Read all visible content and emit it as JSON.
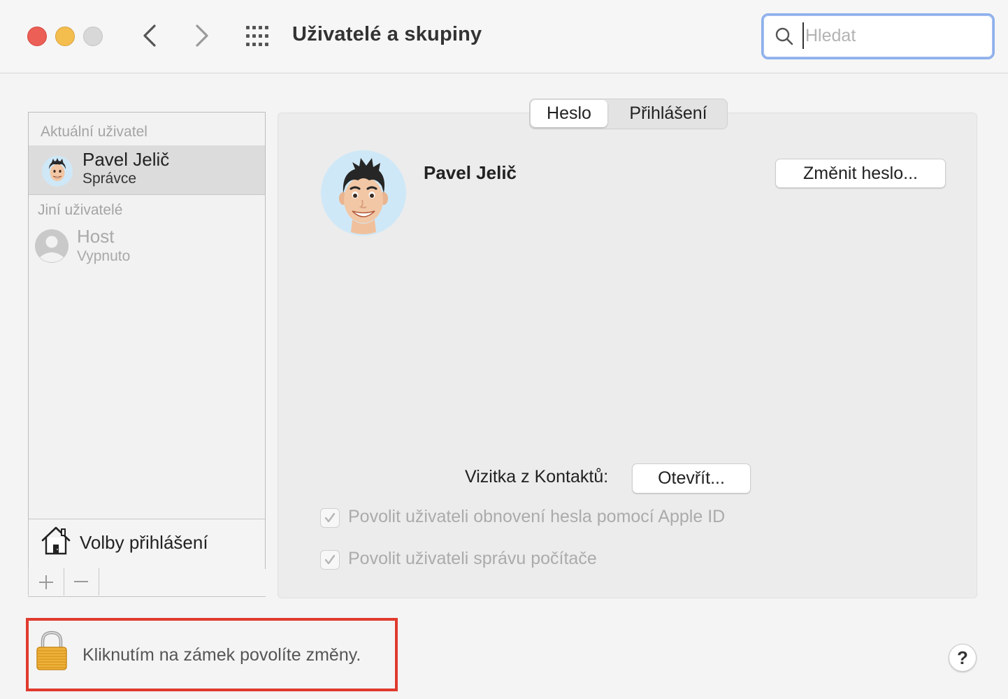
{
  "window": {
    "title": "Uživatelé a skupiny"
  },
  "search": {
    "placeholder": "Hledat",
    "value": ""
  },
  "sidebar": {
    "current_section_label": "Aktuální uživatel",
    "current_user": {
      "name": "Pavel Jelič",
      "role": "Správce"
    },
    "other_section_label": "Jiní uživatelé",
    "guest_user": {
      "name": "Host",
      "status": "Vypnuto"
    },
    "login_options_label": "Volby přihlášení"
  },
  "tabs": {
    "password": "Heslo",
    "login": "Přihlášení"
  },
  "panel": {
    "user_name": "Pavel Jelič",
    "change_password_button": "Změnit heslo...",
    "contact_card_label": "Vizitka z Kontaktů:",
    "open_button": "Otevřít...",
    "check_reset_apple_id": "Povolit uživateli obnovení hesla pomocí Apple ID",
    "check_admin": "Povolit uživateli správu počítače"
  },
  "footer": {
    "lock_text": "Kliknutím na zámek povolíte změny.",
    "help_label": "?"
  },
  "colors": {
    "highlight_border": "#e03a2e",
    "search_focus": "#8fb0ec",
    "avatar_bg": "#cfe8f7"
  },
  "icons": [
    "back-chevron-icon",
    "forward-chevron-icon",
    "grid-icon",
    "search-icon",
    "house-icon",
    "plus-icon",
    "minus-icon",
    "checkmark-icon",
    "lock-icon",
    "help-icon"
  ]
}
